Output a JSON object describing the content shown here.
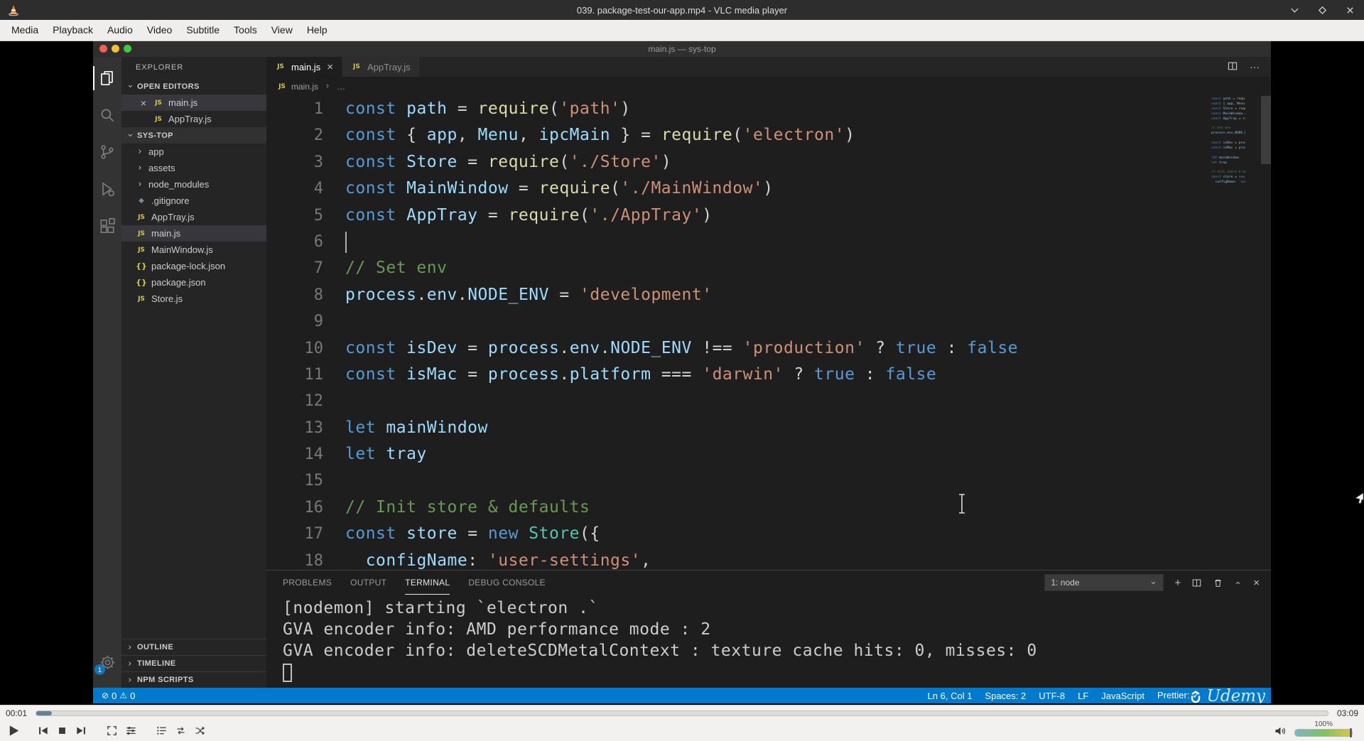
{
  "icons": {
    "close_glyph": "×",
    "chevron_glyph": "›",
    "ellipsis_glyph": "···",
    "plus_glyph": "+",
    "error_glyph": "⊘",
    "warning_glyph": "⚠"
  },
  "vlc": {
    "window_title": "039. package-test-our-app.mp4 - VLC media player",
    "menu_items": [
      "Media",
      "Playback",
      "Audio",
      "Video",
      "Subtitle",
      "Tools",
      "View",
      "Help"
    ],
    "time_elapsed": "00:01",
    "time_total": "03:09",
    "progress_percent": 1.2,
    "volume_label": "100%"
  },
  "vscode": {
    "window_title": "main.js — sys-top",
    "settings_badge": "1",
    "sidebar": {
      "title": "EXPLORER",
      "open_editors_label": "OPEN EDITORS",
      "open_editors": [
        {
          "name": "main.js",
          "type": "js",
          "selected": true,
          "show_close": true
        },
        {
          "name": "AppTray.js",
          "type": "js",
          "selected": false,
          "show_close": false
        }
      ],
      "project_label": "SYS-TOP",
      "tree": [
        {
          "name": "app",
          "type": "folder"
        },
        {
          "name": "assets",
          "type": "folder"
        },
        {
          "name": "node_modules",
          "type": "folder"
        },
        {
          "name": ".gitignore",
          "type": "git"
        },
        {
          "name": "AppTray.js",
          "type": "js"
        },
        {
          "name": "main.js",
          "type": "js",
          "selected": true
        },
        {
          "name": "MainWindow.js",
          "type": "js"
        },
        {
          "name": "package-lock.json",
          "type": "json"
        },
        {
          "name": "package.json",
          "type": "json"
        },
        {
          "name": "Store.js",
          "type": "js"
        }
      ],
      "bottom_sections": [
        "OUTLINE",
        "TIMELINE",
        "NPM SCRIPTS"
      ]
    },
    "tabs": [
      {
        "name": "main.js",
        "type": "js",
        "active": true,
        "show_close": true
      },
      {
        "name": "AppTray.js",
        "type": "js",
        "active": false,
        "show_close": false
      }
    ],
    "breadcrumb": [
      "main.js",
      "…"
    ],
    "editor": {
      "lines": [
        [
          [
            "k",
            "const "
          ],
          [
            "v",
            "path"
          ],
          [
            "p",
            " = "
          ],
          [
            "f",
            "require"
          ],
          [
            "p",
            "("
          ],
          [
            "s",
            "'path'"
          ],
          [
            "p",
            ")"
          ]
        ],
        [
          [
            "k",
            "const "
          ],
          [
            "p",
            "{ "
          ],
          [
            "v",
            "app"
          ],
          [
            "p",
            ", "
          ],
          [
            "v",
            "Menu"
          ],
          [
            "p",
            ", "
          ],
          [
            "v",
            "ipcMain"
          ],
          [
            "p",
            " } = "
          ],
          [
            "f",
            "require"
          ],
          [
            "p",
            "("
          ],
          [
            "s",
            "'electron'"
          ],
          [
            "p",
            ")"
          ]
        ],
        [
          [
            "k",
            "const "
          ],
          [
            "v",
            "Store"
          ],
          [
            "p",
            " = "
          ],
          [
            "f",
            "require"
          ],
          [
            "p",
            "("
          ],
          [
            "s",
            "'./Store'"
          ],
          [
            "p",
            ")"
          ]
        ],
        [
          [
            "k",
            "const "
          ],
          [
            "v",
            "MainWindow"
          ],
          [
            "p",
            " = "
          ],
          [
            "f",
            "require"
          ],
          [
            "p",
            "("
          ],
          [
            "s",
            "'./MainWindow'"
          ],
          [
            "p",
            ")"
          ]
        ],
        [
          [
            "k",
            "const "
          ],
          [
            "v",
            "AppTray"
          ],
          [
            "p",
            " = "
          ],
          [
            "f",
            "require"
          ],
          [
            "p",
            "("
          ],
          [
            "s",
            "'./AppTray'"
          ],
          [
            "p",
            ")"
          ]
        ],
        [],
        [
          [
            "c",
            "// Set env"
          ]
        ],
        [
          [
            "v",
            "process"
          ],
          [
            "p",
            "."
          ],
          [
            "v",
            "env"
          ],
          [
            "p",
            "."
          ],
          [
            "v",
            "NODE_ENV"
          ],
          [
            "p",
            " = "
          ],
          [
            "s",
            "'development'"
          ]
        ],
        [],
        [
          [
            "k",
            "const "
          ],
          [
            "v",
            "isDev"
          ],
          [
            "p",
            " = "
          ],
          [
            "v",
            "process"
          ],
          [
            "p",
            "."
          ],
          [
            "v",
            "env"
          ],
          [
            "p",
            "."
          ],
          [
            "v",
            "NODE_ENV"
          ],
          [
            "p",
            " !== "
          ],
          [
            "s",
            "'production'"
          ],
          [
            "p",
            " ? "
          ],
          [
            "k",
            "true"
          ],
          [
            "p",
            " : "
          ],
          [
            "k",
            "false"
          ]
        ],
        [
          [
            "k",
            "const "
          ],
          [
            "v",
            "isMac"
          ],
          [
            "p",
            " = "
          ],
          [
            "v",
            "process"
          ],
          [
            "p",
            "."
          ],
          [
            "v",
            "platform"
          ],
          [
            "p",
            " === "
          ],
          [
            "s",
            "'darwin'"
          ],
          [
            "p",
            " ? "
          ],
          [
            "k",
            "true"
          ],
          [
            "p",
            " : "
          ],
          [
            "k",
            "false"
          ]
        ],
        [],
        [
          [
            "k",
            "let "
          ],
          [
            "v",
            "mainWindow"
          ]
        ],
        [
          [
            "k",
            "let "
          ],
          [
            "v",
            "tray"
          ]
        ],
        [],
        [
          [
            "c",
            "// Init store & defaults"
          ]
        ],
        [
          [
            "k",
            "const "
          ],
          [
            "v",
            "store"
          ],
          [
            "p",
            " = "
          ],
          [
            "k",
            "new "
          ],
          [
            "t",
            "Store"
          ],
          [
            "p",
            "({"
          ]
        ],
        [
          [
            "p",
            "  "
          ],
          [
            "v",
            "configName"
          ],
          [
            "p",
            ": "
          ],
          [
            "s",
            "'user-settings'"
          ],
          [
            "p",
            ","
          ]
        ]
      ]
    },
    "panel": {
      "tabs": [
        "PROBLEMS",
        "OUTPUT",
        "TERMINAL",
        "DEBUG CONSOLE"
      ],
      "active_tab": "TERMINAL",
      "shell_select": "1: node",
      "terminal_lines": [
        "[nodemon] starting `electron .`",
        "GVA encoder info: AMD performance mode : 2",
        "GVA encoder info: deleteSCDMetalContext : texture cache hits: 0, misses: 0"
      ]
    },
    "status": {
      "errors": "0",
      "warnings": "0",
      "right_items": [
        "Ln 6, Col 1",
        "Spaces: 2",
        "UTF-8",
        "LF",
        "JavaScript",
        "Prettier: ✓"
      ]
    },
    "watermark": "Udemy"
  }
}
